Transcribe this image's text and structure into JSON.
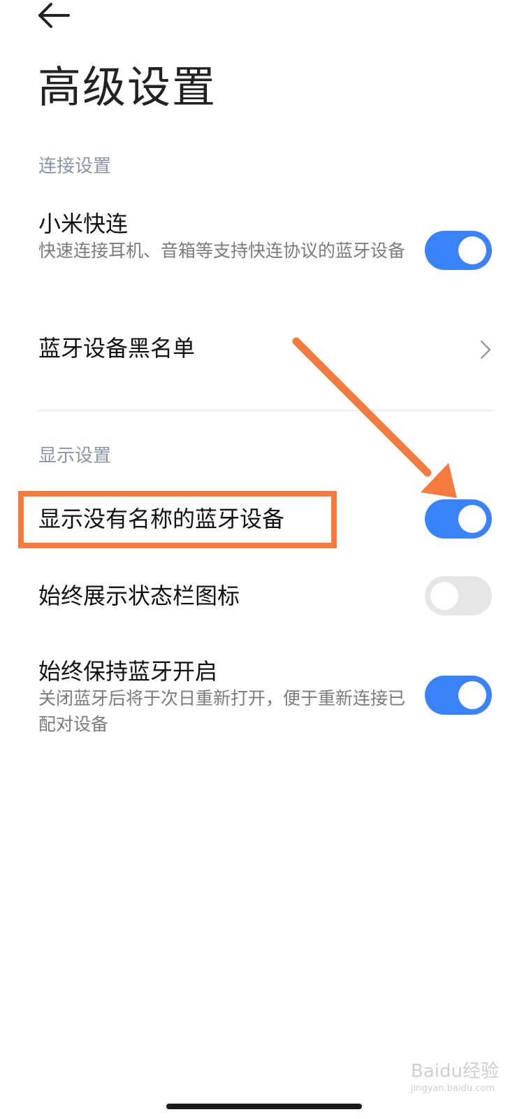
{
  "header": {
    "title": "高级设置"
  },
  "sections": [
    {
      "header": "连接设置",
      "items": [
        {
          "title": "小米快连",
          "subtitle": "快速连接耳机、音箱等支持快连协议的蓝牙设备",
          "control": "toggle",
          "on": true
        },
        {
          "title": "蓝牙设备黑名单",
          "control": "chevron"
        }
      ]
    },
    {
      "header": "显示设置",
      "items": [
        {
          "title": "显示没有名称的蓝牙设备",
          "control": "toggle",
          "on": true
        },
        {
          "title": "始终展示状态栏图标",
          "control": "toggle",
          "on": false
        },
        {
          "title": "始终保持蓝牙开启",
          "subtitle": "关闭蓝牙后将于次日重新打开，便于重新连接已配对设备",
          "control": "toggle",
          "on": true
        }
      ]
    }
  ],
  "colors": {
    "accent": "#3a82f7",
    "toggle_off": "#e6e6e6",
    "annotation": "#f47b3d",
    "section_header": "#8a94a8"
  },
  "icons": {
    "back": "arrow-left-icon",
    "chevron": "chevron-right-icon",
    "annotation_arrow": "annotation-arrow"
  },
  "watermark": {
    "text": "Baidu经验",
    "url": "jingyan.baidu.com"
  }
}
